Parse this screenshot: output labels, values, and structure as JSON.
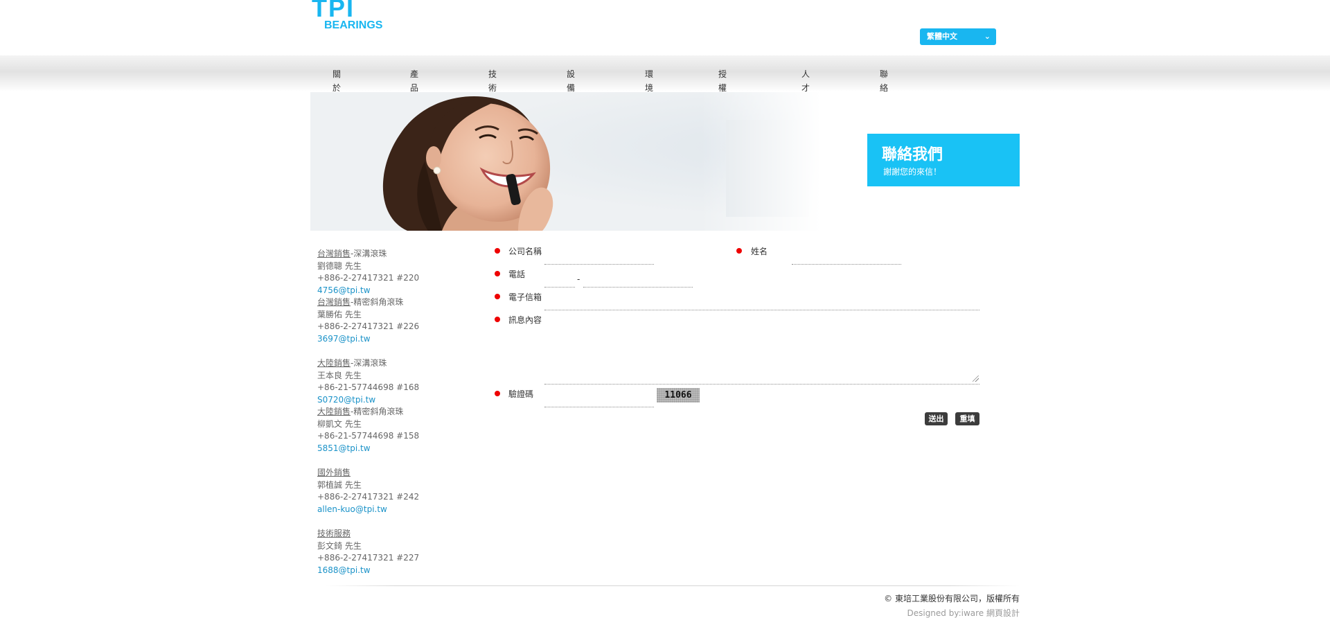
{
  "header": {
    "logo_text": "TPI",
    "logo_subtext": "BEARINGS",
    "language": "繁體中文"
  },
  "nav": {
    "items": [
      {
        "label": "關於東培"
      },
      {
        "label": "產品資訊"
      },
      {
        "label": "技術資料"
      },
      {
        "label": "設備開發"
      },
      {
        "label": "環境保護"
      },
      {
        "label": "授權經銷商"
      },
      {
        "label": "人才招募"
      },
      {
        "label": "聯絡我們"
      }
    ]
  },
  "hero": {
    "title": "聯絡我們",
    "subtitle": "謝謝您的來信！"
  },
  "contacts": [
    {
      "entries": [
        {
          "dept": "台灣銷售",
          "product": "-深溝滾珠",
          "person": "劉德聰 先生",
          "phone": "+886-2-27417321 #220",
          "email": "4756@tpi.tw"
        },
        {
          "dept": "台灣銷售",
          "product": "-精密斜角滾珠",
          "person": "葉勝佑 先生",
          "phone": "+886-2-27417321 #226",
          "email": "3697@tpi.tw"
        }
      ]
    },
    {
      "entries": [
        {
          "dept": "大陸銷售",
          "product": "-深溝滾珠",
          "person": "王本良 先生",
          "phone": "+86-21-57744698 #168",
          "email": "S0720@tpi.tw"
        },
        {
          "dept": "大陸銷售",
          "product": "-精密斜角滾珠",
          "person": "柳凱文 先生",
          "phone": "+86-21-57744698 #158",
          "email": "5851@tpi.tw"
        }
      ]
    },
    {
      "entries": [
        {
          "dept": "國外銷售",
          "product": "",
          "person": "郭植誠 先生",
          "phone": "+886-2-27417321 #242",
          "email": "allen-kuo@tpi.tw"
        }
      ]
    },
    {
      "entries": [
        {
          "dept": "技術服務",
          "product": "",
          "person": "彭文錡 先生",
          "phone": "+886-2-27417321 #227",
          "email": "1688@tpi.tw"
        }
      ]
    }
  ],
  "form": {
    "company_label": "公司名稱",
    "name_label": "姓名",
    "phone_label": "電話",
    "phone_separator": "-",
    "email_label": "電子信箱",
    "message_label": "訊息內容",
    "captcha_label": "驗證碼",
    "captcha_code": "11066",
    "submit_label": "送出",
    "reset_label": "重填"
  },
  "footer": {
    "copyright": "© 東培工業股份有限公司，版權所有",
    "designed_by": "Designed by:iware 網頁設計"
  },
  "colors": {
    "brand": "#19b6f0",
    "hero_box": "#19c2f5",
    "required_dot": "#ee0000",
    "button": "#3c3c3c",
    "email_link": "#1a92c8"
  }
}
